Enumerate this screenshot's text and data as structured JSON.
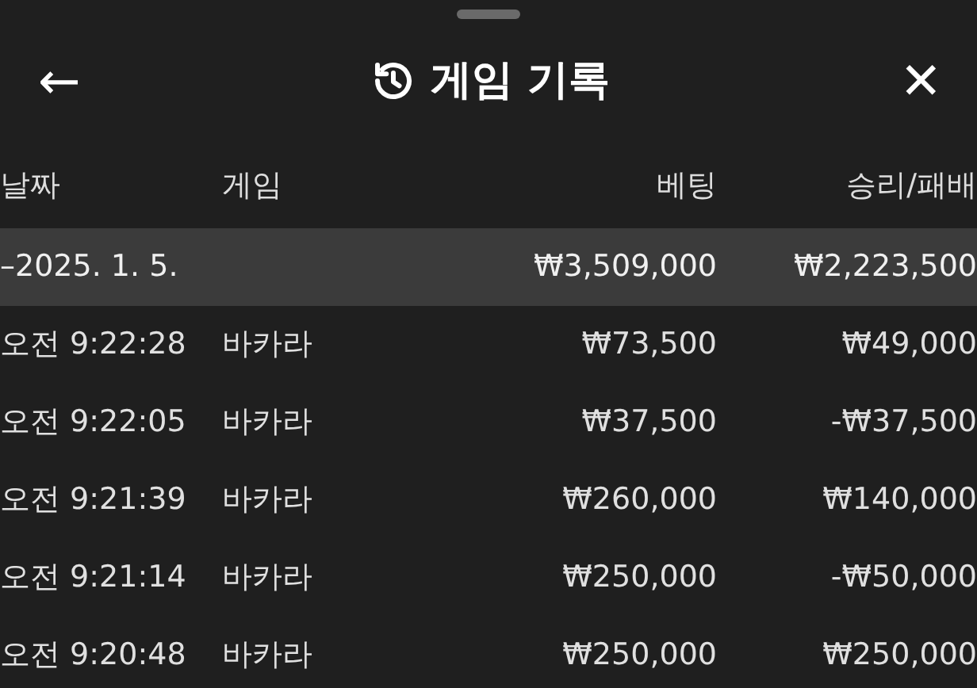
{
  "header": {
    "back": "←",
    "title": "게임 기록",
    "close": "✕"
  },
  "columns": [
    "날짜",
    "게임",
    "베팅",
    "승리/패배"
  ],
  "groups": [
    {
      "label": "–2025. 1. 5.",
      "bet": "₩3,509,000",
      "result": "₩2,223,500",
      "selected": true,
      "rows": [
        {
          "time": "오전 9:22:28",
          "game": "바카라",
          "bet": "₩73,500",
          "result": "₩49,000"
        },
        {
          "time": "오전 9:22:05",
          "game": "바카라",
          "bet": "₩37,500",
          "result": "-₩37,500"
        },
        {
          "time": "오전 9:21:39",
          "game": "바카라",
          "bet": "₩260,000",
          "result": "₩140,000"
        },
        {
          "time": "오전 9:21:14",
          "game": "바카라",
          "bet": "₩250,000",
          "result": "-₩50,000"
        },
        {
          "time": "오전 9:20:48",
          "game": "바카라",
          "bet": "₩250,000",
          "result": "₩250,000"
        }
      ]
    }
  ]
}
